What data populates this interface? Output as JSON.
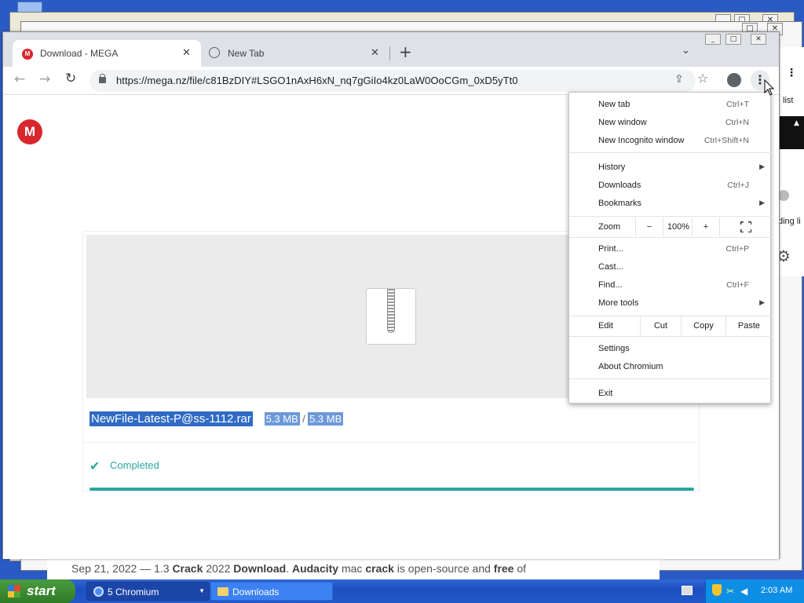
{
  "browser": {
    "tabs": [
      {
        "title": "Download - MEGA",
        "icon": "mega-logo-icon"
      },
      {
        "title": "New Tab",
        "icon": "globe-icon"
      }
    ],
    "url": "https://mega.nz/file/c81BzDIY#LSGO1nAxH6xN_nq7gGiIo4kz0LaW0OoCGm_0xD5yTt0"
  },
  "mega": {
    "file_name": "NewFile-Latest-P@ss-1112.rar",
    "downloaded": "5.3 MB",
    "separator": "/",
    "total": "5.3 MB",
    "status": "Completed",
    "progress": 1.0,
    "accent": "#d9272e",
    "status_color": "#2ba6a0"
  },
  "menu": {
    "new_tab": "New tab",
    "new_tab_sc": "Ctrl+T",
    "new_window": "New window",
    "new_window_sc": "Ctrl+N",
    "incognito": "New Incognito window",
    "incognito_sc": "Ctrl+Shift+N",
    "history": "History",
    "downloads": "Downloads",
    "downloads_sc": "Ctrl+J",
    "bookmarks": "Bookmarks",
    "zoom": "Zoom",
    "zoom_minus": "−",
    "zoom_value": "100%",
    "zoom_plus": "+",
    "print": "Print...",
    "print_sc": "Ctrl+P",
    "cast": "Cast...",
    "find": "Find...",
    "find_sc": "Ctrl+F",
    "more_tools": "More tools",
    "edit": "Edit",
    "cut": "Cut",
    "copy": "Copy",
    "paste": "Paste",
    "settings": "Settings",
    "about": "About Chromium",
    "exit": "Exit"
  },
  "background": {
    "side_list_label": "list",
    "side_loading_label": "ding li",
    "snippet": {
      "date": "Sep 21, 2022 — 1.3 ",
      "w1": "Crack",
      "t1": " 2022 ",
      "w2": "Download",
      "t2": ". ",
      "w3": "Audacity",
      "t3": " mac ",
      "w4": "crack",
      "t4": " is open-source and ",
      "w5": "free",
      "t5": " of"
    }
  },
  "taskbar": {
    "start": "start",
    "items": [
      {
        "label": "5 Chromium",
        "icon": "chromium-icon"
      },
      {
        "label": "Downloads",
        "icon": "folder-icon"
      }
    ],
    "clock": "2:03 AM"
  }
}
